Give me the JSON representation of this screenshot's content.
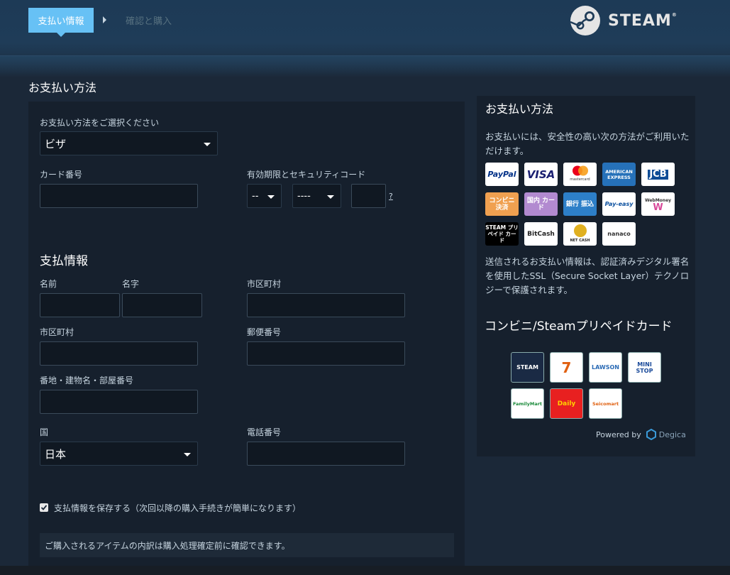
{
  "header": {
    "steps": [
      {
        "label": "支払い情報",
        "active": true
      },
      {
        "label": "確認と購入",
        "active": false
      }
    ],
    "brand": "STEAM",
    "brand_mark": "®"
  },
  "page_title": "お支払い方法",
  "form": {
    "payment_method_label": "お支払い方法をご選択ください",
    "payment_method_value": "ビザ",
    "card_number_label": "カード番号",
    "expiry_label": "有効期限とセキュリティコード",
    "expiry_month_value": "--",
    "expiry_year_value": "----",
    "security_help": "?",
    "billing_title": "支払情報",
    "first_name_label": "名前",
    "last_name_label": "名字",
    "city_label": "市区町村",
    "city2_label": "市区町村",
    "postal_label": "郵便番号",
    "address_label": "番地・建物名・部屋番号",
    "country_label": "国",
    "country_value": "日本",
    "phone_label": "電話番号",
    "save_label": "支払情報を保存する（次回以降の購入手続きが簡単になります）",
    "save_checked": true,
    "notice": "ご購入されるアイテムの内訳は購入処理確定前に確認できます。"
  },
  "sidebar": {
    "title": "お支払い方法",
    "intro": "お支払いには、安全性の高い次の方法がご利用いただけます。",
    "payment_logos": [
      {
        "name": "paypal",
        "text": "PayPal"
      },
      {
        "name": "visa",
        "text": "VISA"
      },
      {
        "name": "mastercard",
        "text": "mastercard"
      },
      {
        "name": "amex",
        "text": "AMERICAN EXPRESS"
      },
      {
        "name": "jcb",
        "text": "JCB"
      },
      {
        "name": "konbini",
        "text": "コンビニ 決済"
      },
      {
        "name": "domestic-card",
        "text": "国内 カード"
      },
      {
        "name": "bank-transfer",
        "text": "銀行 振込"
      },
      {
        "name": "payeasy",
        "text": "Pay-easy"
      },
      {
        "name": "webmoney",
        "text": "WebMoney"
      },
      {
        "name": "steam-prepaid",
        "text": "STEAM プリペイド カード"
      },
      {
        "name": "bitcash",
        "text": "BitCash"
      },
      {
        "name": "netcash",
        "text": "NET CASH"
      },
      {
        "name": "nanaco",
        "text": "nanaco"
      }
    ],
    "security_text": "送信されるお支払い情報は、認証済みデジタル署名を使用したSSL（Secure Socket Layer）テクノロジーで保護されます。",
    "konbini_title": "コンビニ/Steamプリペイドカード",
    "stores": [
      {
        "name": "steam-card",
        "text": "STEAM"
      },
      {
        "name": "seven-eleven",
        "text": "7"
      },
      {
        "name": "lawson",
        "text": "LAWSON"
      },
      {
        "name": "ministop",
        "text": "MINI STOP"
      },
      {
        "name": "familymart",
        "text": "FamilyMart"
      },
      {
        "name": "daily-yamazaki",
        "text": "Daily"
      },
      {
        "name": "seicomart",
        "text": "Seicomart"
      }
    ],
    "powered_by": "Powered by",
    "powered_brand": "Degica"
  }
}
